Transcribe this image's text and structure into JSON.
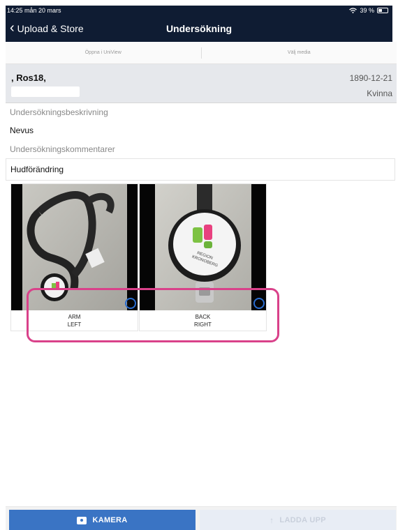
{
  "status_bar": {
    "time_date": "14:25  mån 20 mars",
    "battery": "39 %"
  },
  "nav": {
    "back_label": "Upload & Store",
    "title": "Undersökning"
  },
  "tabs": [
    {
      "label": "Öppna i UniView"
    },
    {
      "label": "Välj media"
    }
  ],
  "patient": {
    "name": ", Ros18,",
    "birth_date": "1890-12-21",
    "sex": "Kvinna"
  },
  "exam": {
    "description_label": "Undersökningsbeskrivning",
    "description_value": "Nevus",
    "comment_label": "Undersökningskommentarer",
    "comment_value": "Hudförändring"
  },
  "images": [
    {
      "line1": "ARM",
      "line2": "LEFT"
    },
    {
      "line1": "BACK",
      "line2": "RIGHT"
    }
  ],
  "photo_text": {
    "badge_line1": "REGION",
    "badge_line2": "KRONOBERG"
  },
  "buttons": {
    "camera": "KAMERA",
    "upload": "LADDA UPP"
  },
  "colors": {
    "nav_bg": "#0f1c33",
    "camera_btn": "#3a74c4",
    "upload_btn_disabled": "#e8edf5",
    "highlight": "#d9418a",
    "radio": "#2a6dd0"
  },
  "icons": {
    "back": "chevron-left-icon",
    "wifi": "wifi-icon",
    "battery": "battery-icon",
    "camera": "camera-icon",
    "upload": "upload-arrow-icon"
  }
}
